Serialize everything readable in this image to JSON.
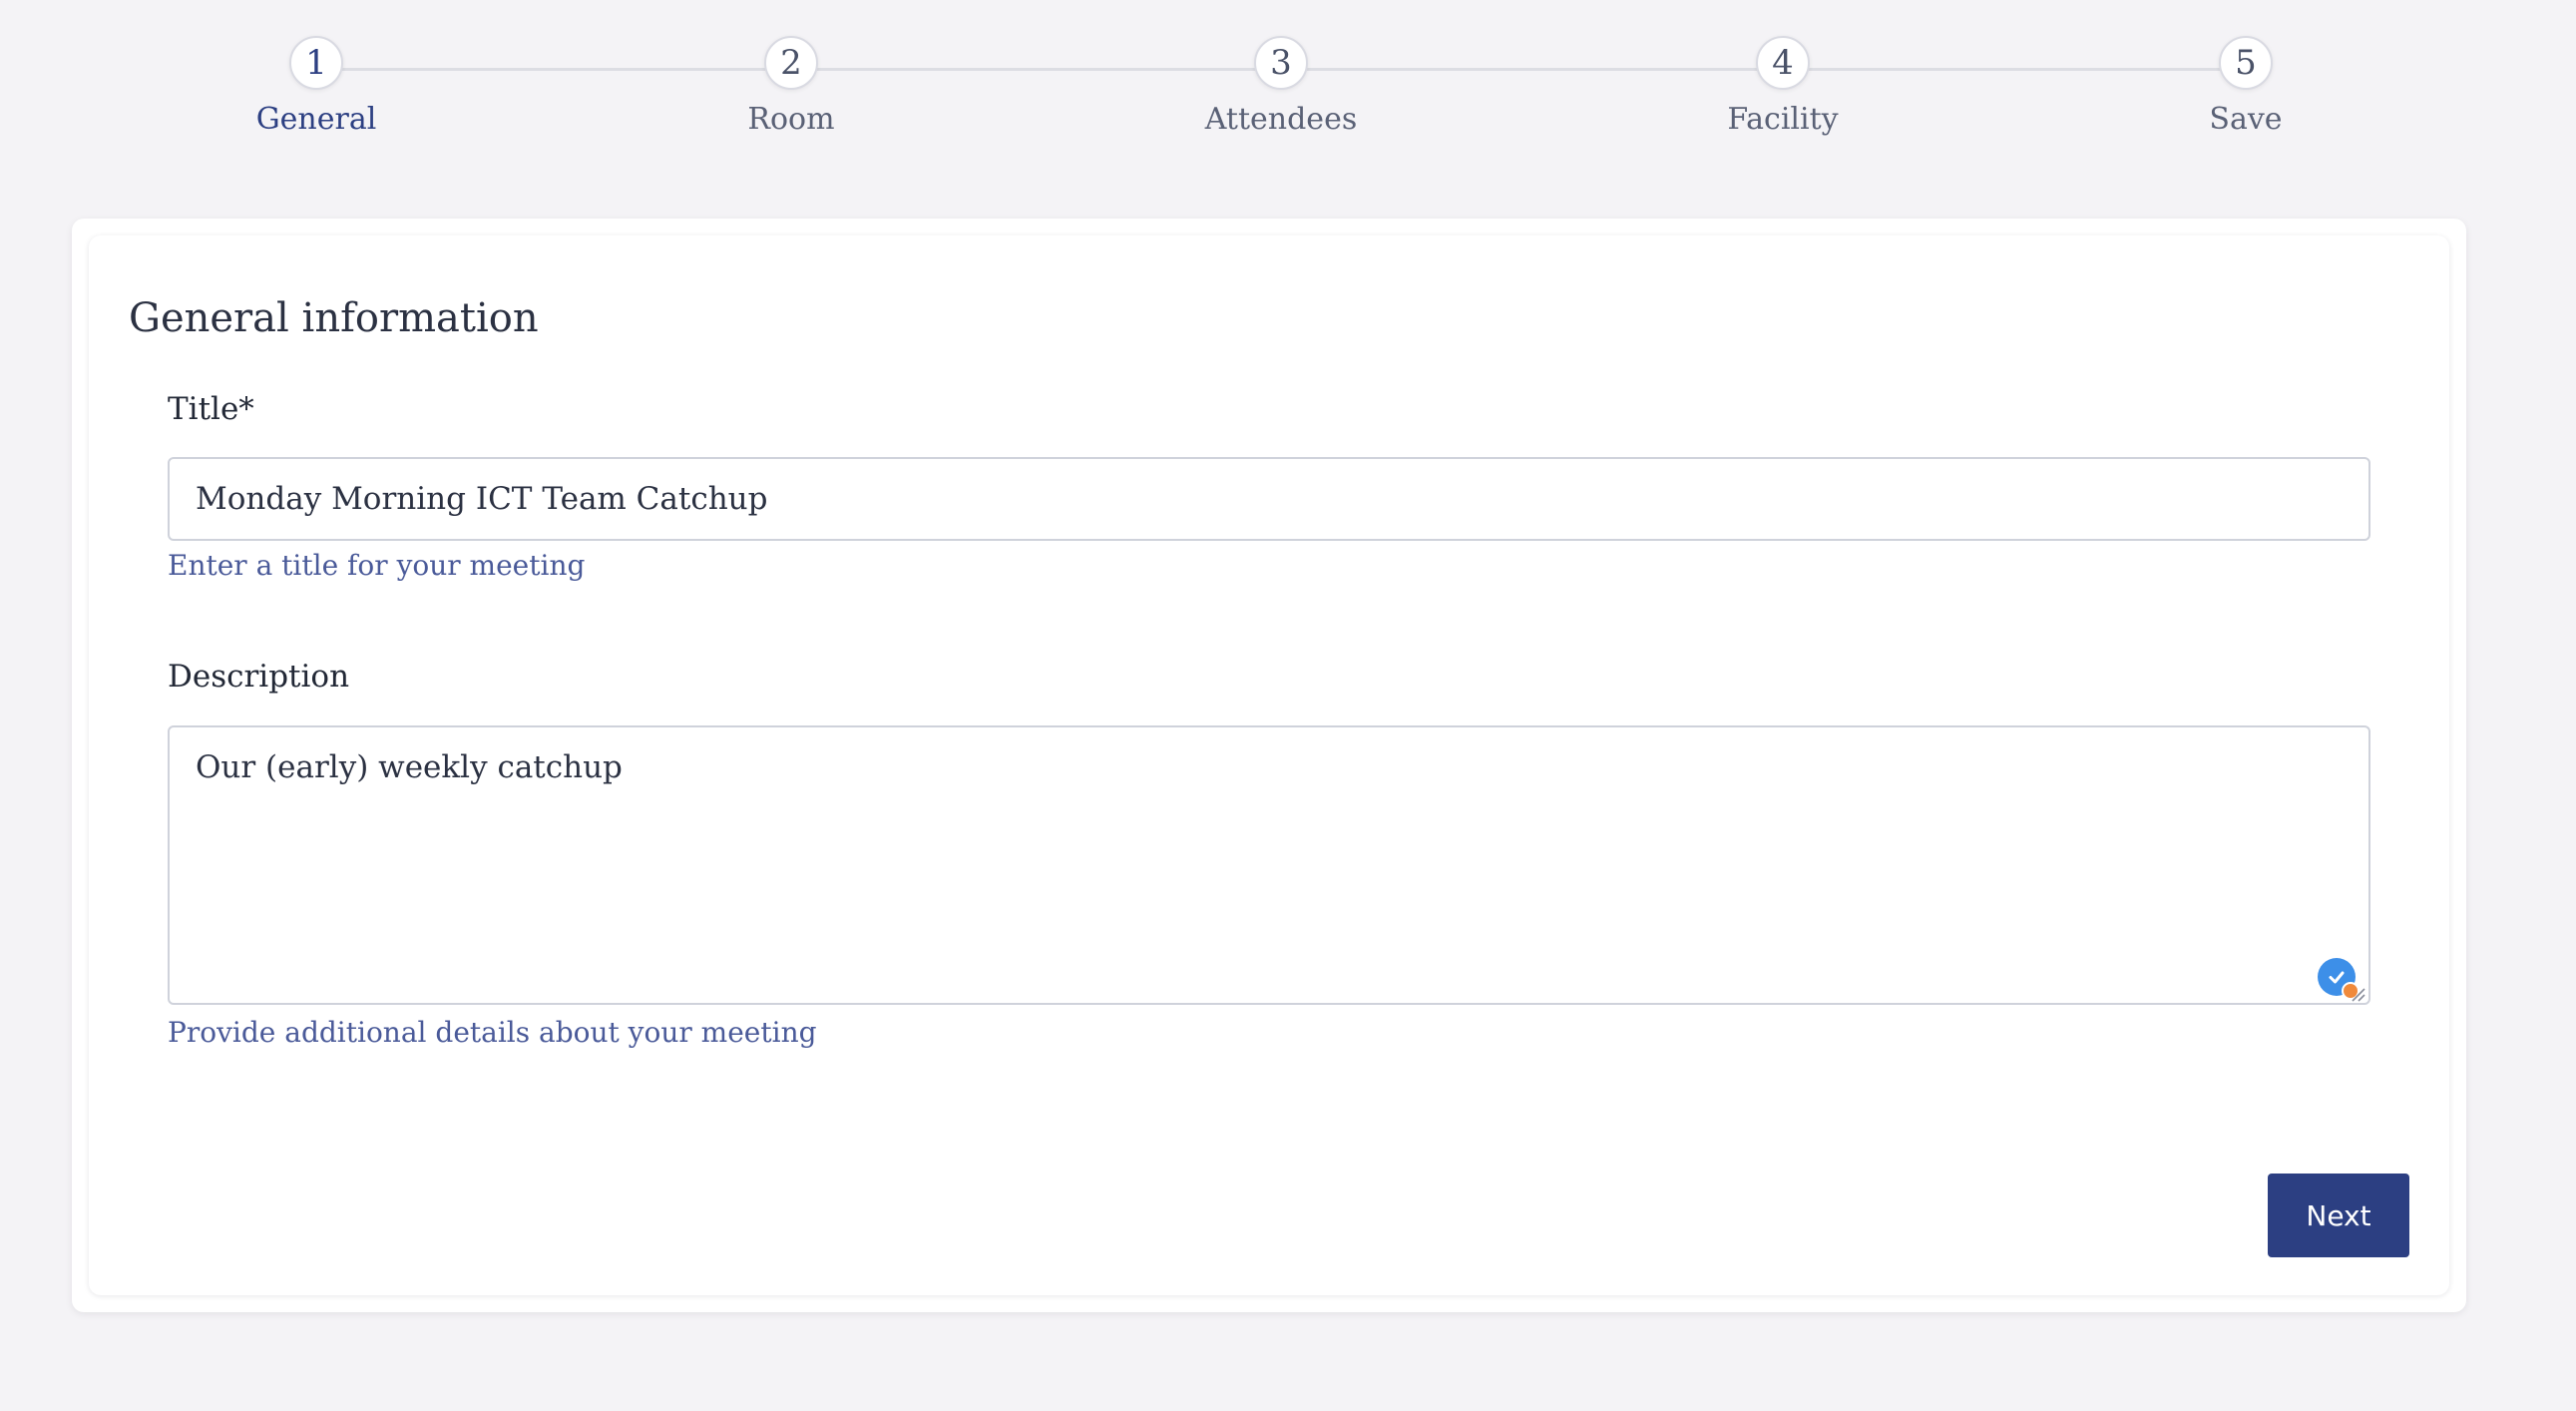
{
  "stepper": {
    "steps": [
      {
        "number": "1",
        "label": "General",
        "active": true
      },
      {
        "number": "2",
        "label": "Room",
        "active": false
      },
      {
        "number": "3",
        "label": "Attendees",
        "active": false
      },
      {
        "number": "4",
        "label": "Facility",
        "active": false
      },
      {
        "number": "5",
        "label": "Save",
        "active": false
      }
    ]
  },
  "form": {
    "heading": "General information",
    "title": {
      "label": "Title*",
      "value": "Monday Morning ICT Team Catchup",
      "help": "Enter a title for your meeting"
    },
    "description": {
      "label": "Description",
      "value": "Our (early) weekly catchup",
      "help": "Provide additional details about your meeting"
    },
    "next_label": "Next"
  },
  "icons": {
    "grammar_checker": "check-badge-icon",
    "resize": "resize-grip-icon"
  },
  "colors": {
    "accent": "#2c3f82",
    "help_text": "#4a5a99",
    "background": "#f4f3f6",
    "badge": "#3d8fe8",
    "badge_dot": "#f08a3c"
  }
}
